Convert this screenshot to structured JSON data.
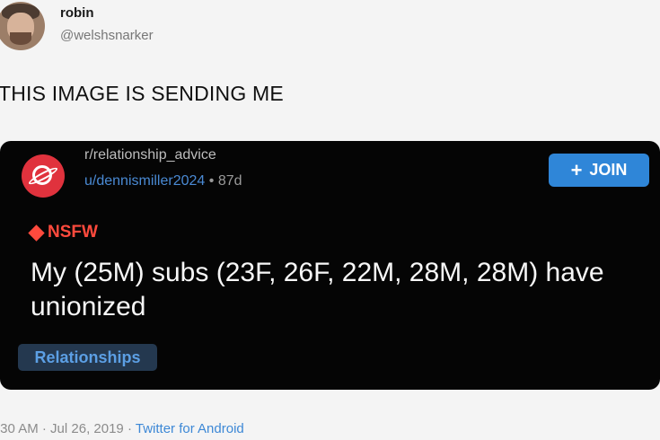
{
  "tweet": {
    "name": "robin",
    "handle": "@welshsnarker",
    "text": "THIS IMAGE IS SENDING ME"
  },
  "reddit_post": {
    "subreddit": "r/relationship_advice",
    "username": "u/dennismiller2024",
    "age": "87d",
    "join_label": "JOIN",
    "nsfw_label": "NSFW",
    "title": "My (25M) subs (23F, 26F, 22M, 28M, 28M) have unionized",
    "flair": "Relationships"
  },
  "footer": {
    "time": ":30 AM",
    "date": "Jul 26, 2019",
    "source": "Twitter for Android"
  },
  "colors": {
    "background": "#f4f4f4",
    "post_background": "#050505",
    "accent": "#2f86d8",
    "nsfw": "#ff4a3d"
  }
}
